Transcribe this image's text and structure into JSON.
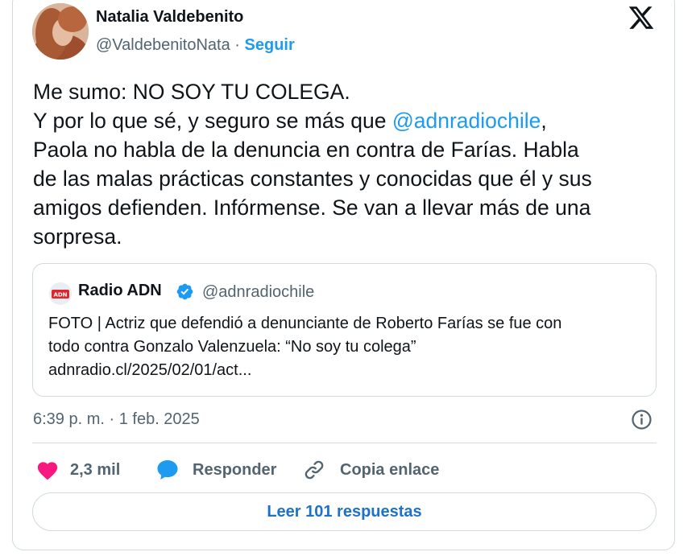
{
  "author": {
    "name": "Natalia Valdebenito",
    "handle": "@ValdebenitoNata",
    "separator": "·",
    "follow_label": "Seguir"
  },
  "tweet": {
    "lines": [
      "Me sumo: NO SOY TU COLEGA.",
      "Y por lo que sé, y seguro se más que ",
      "Paola no habla de la denuncia en contra de Farías. Habla",
      "de las malas prácticas constantes y conocidas que él y sus",
      "amigos defienden. Infórmense. Se van a llevar más de una",
      "sorpresa."
    ],
    "mention": "@adnradiochile",
    "mention_suffix": ","
  },
  "quote": {
    "name": "Radio ADN",
    "handle": "@adnradiochile",
    "logo_text": "ADN",
    "text_line1": "FOTO | Actriz que defendió a denunciante de Roberto Farías se fue con",
    "text_line2": "todo contra Gonzalo Valenzuela: “No soy tu colega”",
    "link": "adnradio.cl/2025/02/01/act..."
  },
  "meta": {
    "timestamp": "6:39 p. m. · 1 feb. 2025"
  },
  "actions": {
    "likes": "2,3 mil",
    "reply_label": "Responder",
    "copy_label": "Copia enlace"
  },
  "footer": {
    "read_replies": "Leer 101 respuestas"
  },
  "colors": {
    "accent": "#1d9bf0",
    "like": "#f91880",
    "text": "#0f1419",
    "muted": "#536471",
    "border": "#cfd9de"
  },
  "icons": [
    "x-logo-icon",
    "verified-icon",
    "info-icon",
    "heart-icon",
    "reply-bubble-icon",
    "link-icon"
  ]
}
